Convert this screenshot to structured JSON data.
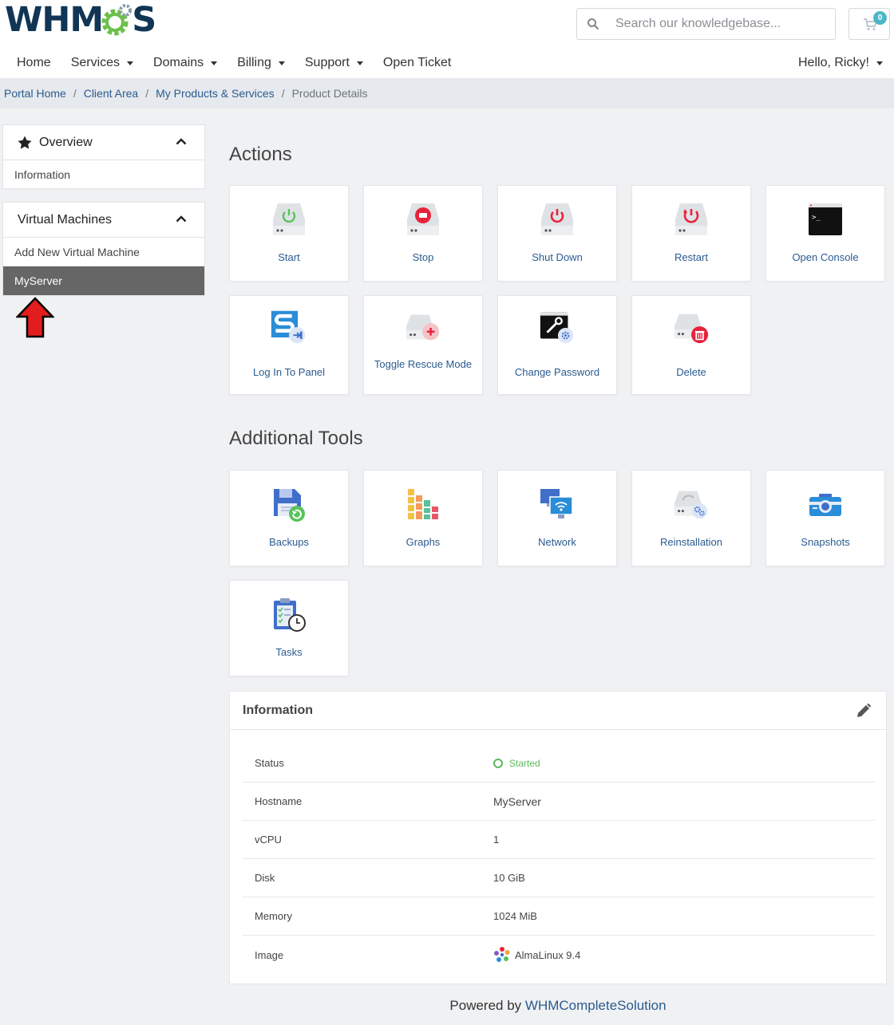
{
  "logo": {
    "text_left": "WHM",
    "text_right": "S"
  },
  "search": {
    "placeholder": "Search our knowledgebase..."
  },
  "cart": {
    "count": "0"
  },
  "nav": {
    "items": [
      {
        "label": "Home"
      },
      {
        "label": "Services"
      },
      {
        "label": "Domains"
      },
      {
        "label": "Billing"
      },
      {
        "label": "Support"
      },
      {
        "label": "Open Ticket"
      }
    ],
    "user_greeting": "Hello, Ricky!"
  },
  "breadcrumb": {
    "items": [
      "Portal Home",
      "Client Area",
      "My Products & Services"
    ],
    "active": "Product Details",
    "separator": "/"
  },
  "sidebar": {
    "overview": {
      "title": "Overview",
      "items": [
        "Information"
      ]
    },
    "virtual_machines": {
      "title": "Virtual Machines",
      "items": [
        "Add New Virtual Machine",
        "MyServer"
      ]
    }
  },
  "actions": {
    "title": "Actions",
    "tiles": [
      "Start",
      "Stop",
      "Shut Down",
      "Restart",
      "Open Console",
      "Log In To Panel",
      "Toggle Rescue Mode",
      "Change Password",
      "Delete"
    ]
  },
  "tools": {
    "title": "Additional Tools",
    "tiles": [
      "Backups",
      "Graphs",
      "Network",
      "Reinstallation",
      "Snapshots",
      "Tasks"
    ]
  },
  "information": {
    "title": "Information",
    "rows": [
      {
        "label": "Status",
        "value": "Started"
      },
      {
        "label": "Hostname",
        "value": "MyServer"
      },
      {
        "label": "vCPU",
        "value": "1"
      },
      {
        "label": "Disk",
        "value": "10 GiB"
      },
      {
        "label": "Memory",
        "value": "1024 MiB"
      },
      {
        "label": "Image",
        "value": "AlmaLinux 9.4"
      }
    ]
  },
  "footer": {
    "prefix": "Powered by ",
    "link": "WHMCompleteSolution"
  },
  "colors": {
    "link": "#2a5b8f",
    "active_sidebar": "#666666",
    "started": "#5cb85c",
    "badge": "#4cb6c9",
    "logo_navy": "#113555",
    "logo_green": "#6cc04a"
  }
}
